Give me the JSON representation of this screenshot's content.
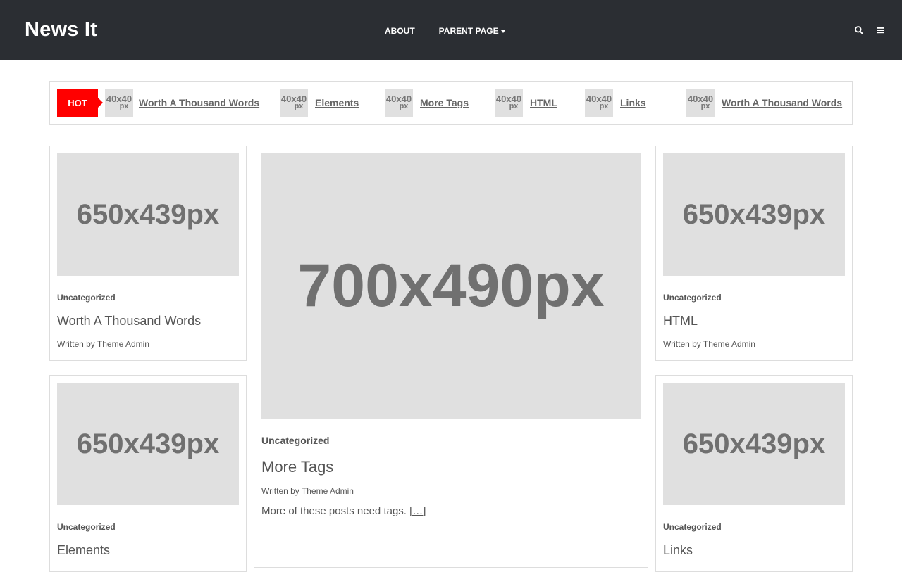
{
  "header": {
    "logo": "News It",
    "nav": [
      {
        "label": "ABOUT"
      },
      {
        "label": "PARENT PAGE"
      }
    ]
  },
  "ticker": {
    "badge": "HOT",
    "thumb_text": [
      "40x40",
      "px"
    ],
    "items": [
      {
        "label": "Worth A Thousand Words"
      },
      {
        "label": "Elements"
      },
      {
        "label": "More Tags"
      },
      {
        "label": "HTML"
      },
      {
        "label": "Links"
      },
      {
        "label": "Worth A Thousand Words"
      }
    ]
  },
  "posts": {
    "written_by": "Written by",
    "card1": {
      "image": "650x439px",
      "category": "Uncategorized",
      "title": "Worth A Thousand Words",
      "author": "Theme Admin"
    },
    "featured": {
      "image": "700x490px",
      "category": "Uncategorized",
      "title": "More Tags",
      "author": "Theme Admin",
      "excerpt": "More of these posts need tags.",
      "more": "[…]"
    },
    "card3": {
      "image": "650x439px",
      "category": "Uncategorized",
      "title": "HTML",
      "author": "Theme Admin"
    },
    "card4": {
      "image": "650x439px",
      "category": "Uncategorized",
      "title": "Elements"
    },
    "card5": {
      "image": "650x439px",
      "category": "Uncategorized",
      "title": "Links"
    }
  },
  "colors": {
    "header_bg": "#2b2e33",
    "hot_badge": "#ff0000",
    "placeholder_bg": "#e0e0e0"
  }
}
